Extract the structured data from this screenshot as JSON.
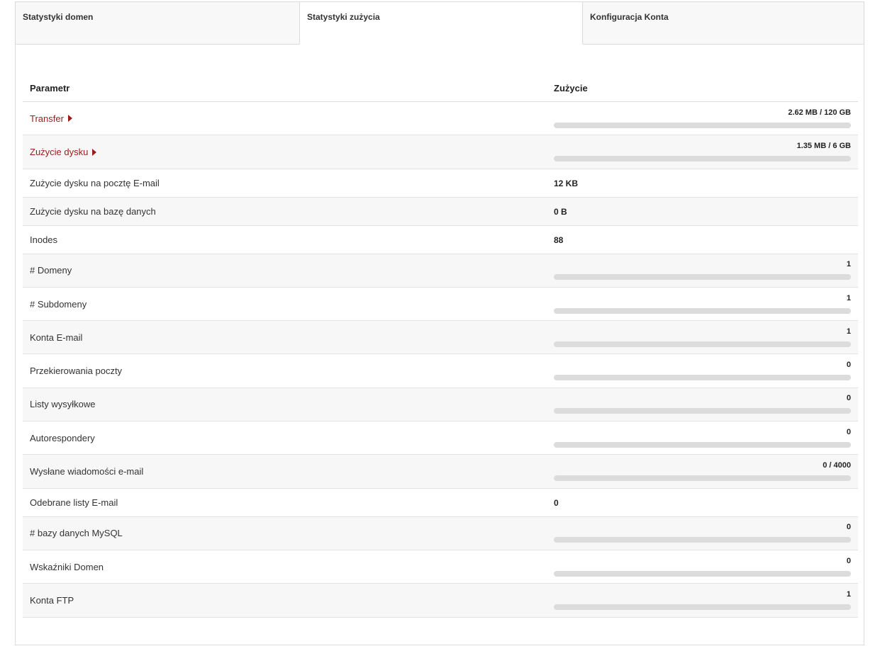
{
  "tabs": [
    "Statystyki domen",
    "Statystyki zużycia",
    "Konfiguracja Konta"
  ],
  "table": {
    "col_param": "Parametr",
    "col_usage": "Zużycie",
    "rows": [
      {
        "label": "Transfer",
        "value": "2.62 MB / 120 GB",
        "bar": true,
        "link": true,
        "fraction": 0.0
      },
      {
        "label": "Zużycie dysku",
        "value": "1.35 MB / 6 GB",
        "bar": true,
        "link": true,
        "fraction": 0.0
      },
      {
        "label": "Zużycie dysku na pocztę E-mail",
        "value": "12 KB",
        "bar": false
      },
      {
        "label": "Zużycie dysku na bazę danych",
        "value": "0 B",
        "bar": false
      },
      {
        "label": "Inodes",
        "value": "88",
        "bar": false
      },
      {
        "label": "# Domeny",
        "value": "1",
        "bar": true,
        "fraction": 0.0
      },
      {
        "label": "# Subdomeny",
        "value": "1",
        "bar": true,
        "fraction": 0.0
      },
      {
        "label": "Konta E-mail",
        "value": "1",
        "bar": true,
        "fraction": 0.0
      },
      {
        "label": "Przekierowania poczty",
        "value": "0",
        "bar": true,
        "fraction": 0.0
      },
      {
        "label": "Listy wysyłkowe",
        "value": "0",
        "bar": true,
        "fraction": 0.0
      },
      {
        "label": "Autorespondery",
        "value": "0",
        "bar": true,
        "fraction": 0.0
      },
      {
        "label": "Wysłane wiadomości e-mail",
        "value": "0 / 4000",
        "bar": true,
        "fraction": 0.0
      },
      {
        "label": "Odebrane listy E-mail",
        "value": "0",
        "bar": false
      },
      {
        "label": "# bazy danych MySQL",
        "value": "0",
        "bar": true,
        "fraction": 0.0
      },
      {
        "label": "Wskaźniki Domen",
        "value": "0",
        "bar": true,
        "fraction": 0.0
      },
      {
        "label": "Konta FTP",
        "value": "1",
        "bar": true,
        "fraction": 0.0
      }
    ]
  },
  "colors": {
    "link": "#9b1c1c",
    "track": "#dcdcdc",
    "fill": "#b22222"
  }
}
